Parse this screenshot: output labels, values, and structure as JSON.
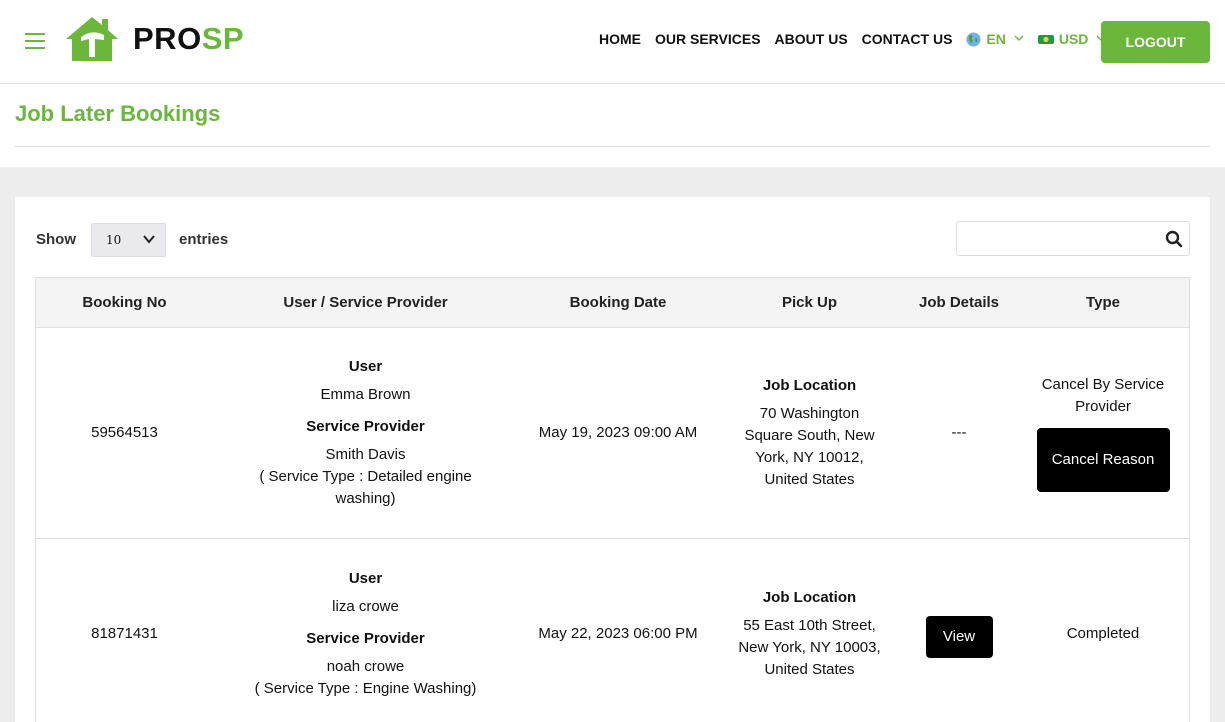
{
  "header": {
    "logo": {
      "part1": "PRO",
      "part2": "SP"
    },
    "nav": [
      {
        "label": "HOME"
      },
      {
        "label": "OUR SERVICES"
      },
      {
        "label": "ABOUT US"
      },
      {
        "label": "CONTACT US"
      }
    ],
    "language": {
      "icon": "globe-icon",
      "value": "EN"
    },
    "currency": {
      "icon": "banknote-icon",
      "value": "USD"
    },
    "logout_label": "LOGOUT"
  },
  "page": {
    "title": "Job Later Bookings"
  },
  "table_controls": {
    "show_label": "Show",
    "entries_value": "10",
    "entries_label": "entries",
    "search_value": "",
    "search_placeholder": ""
  },
  "table": {
    "headers": [
      "Booking No",
      "User / Service Provider",
      "Booking Date",
      "Pick Up",
      "Job Details",
      "Type"
    ],
    "rows": [
      {
        "booking_no": "59564513",
        "user_label": "User",
        "user": "Emma Brown",
        "provider_label": "Service Provider",
        "provider": "Smith Davis",
        "service_type": "( Service Type : Detailed engine washing)",
        "booking_date": "May 19, 2023 09:00 AM",
        "pickup_label": "Job Location",
        "pickup": "70 Washington Square South, New York, NY 10012, United States",
        "job_details": "---",
        "type": "Cancel By Service Provider",
        "action_label": "Cancel Reason"
      },
      {
        "booking_no": "81871431",
        "user_label": "User",
        "user": "liza crowe",
        "provider_label": "Service Provider",
        "provider": "noah crowe",
        "service_type": "( Service Type : Engine Washing)",
        "booking_date": "May 22, 2023 06:00 PM",
        "pickup_label": "Job Location",
        "pickup": "55 East 10th Street, New York, NY 10003, United States",
        "job_details_action": "View",
        "type": "Completed"
      }
    ]
  },
  "colors": {
    "brand_green": "#6ab73c",
    "button_black": "#000000",
    "page_gray": "#ededed"
  }
}
